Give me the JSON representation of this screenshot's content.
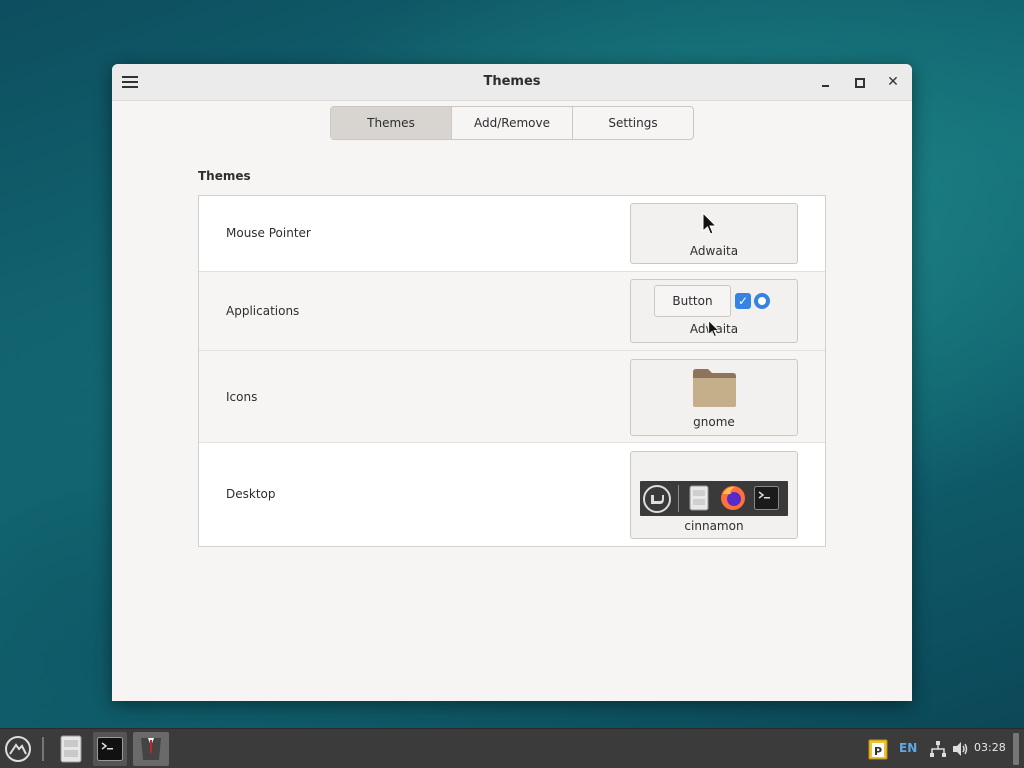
{
  "window": {
    "title": "Themes",
    "close_glyph": "✕"
  },
  "tabs": [
    {
      "label": "Themes",
      "active": true
    },
    {
      "label": "Add/Remove",
      "active": false
    },
    {
      "label": "Settings",
      "active": false
    }
  ],
  "section": {
    "title": "Themes"
  },
  "rows": [
    {
      "label": "Mouse Pointer",
      "value": "Adwaita",
      "icon": "cursor-arrow-icon"
    },
    {
      "label": "Applications",
      "value": "Adwaita",
      "preview_button_label": "Button",
      "icon": "gtk-widget-preview"
    },
    {
      "label": "Icons",
      "value": "gnome",
      "icon": "folder-icon"
    },
    {
      "label": "Desktop",
      "value": "cinnamon",
      "icon": "desktop-panel-preview"
    }
  ],
  "taskbar": {
    "clock": "03:28",
    "keyboard_layout": "EN",
    "items": [
      "menu-icon",
      "file-manager-icon",
      "terminal-icon",
      "themes-app-icon"
    ],
    "tray": [
      "clipboard-icon",
      "network-icon",
      "volume-icon"
    ]
  },
  "colors": {
    "accent": "#3584e4",
    "window_bg": "#f6f5f4",
    "taskbar_bg": "#3b3b3b",
    "folder": "#b9a37f"
  }
}
